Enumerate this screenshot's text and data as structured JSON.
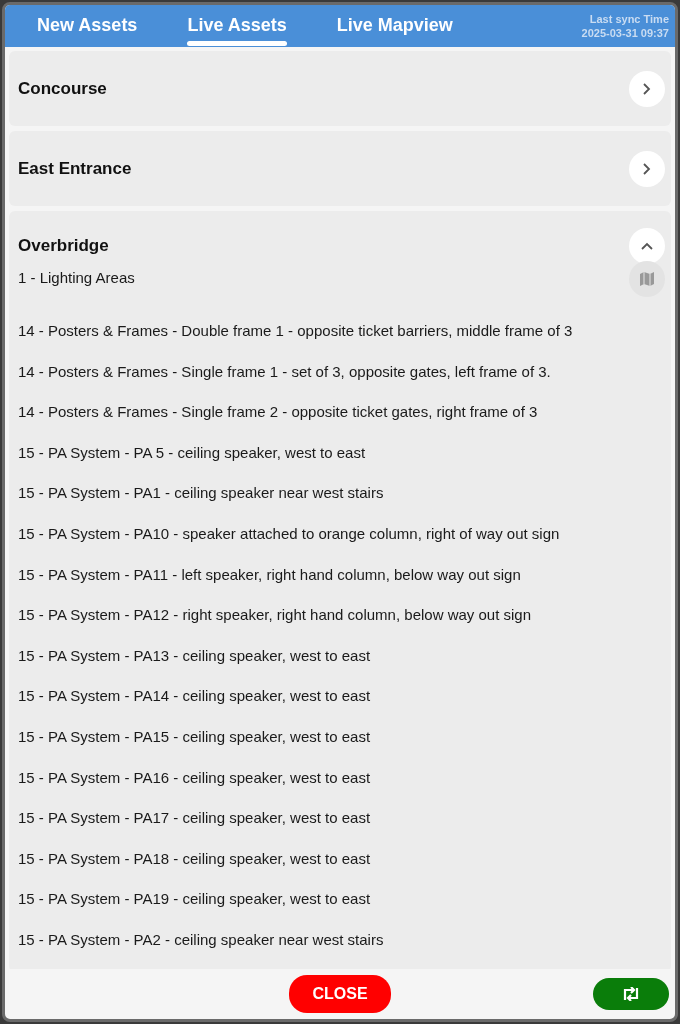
{
  "tabs": [
    {
      "label": "New Assets",
      "selected": false
    },
    {
      "label": "Live Assets",
      "selected": true
    },
    {
      "label": "Live Mapview",
      "selected": false
    }
  ],
  "sync": {
    "label": "Last sync Time",
    "time": "2025-03-31 09:37"
  },
  "sections": [
    {
      "title": "Concourse",
      "expanded": false
    },
    {
      "title": "East Entrance",
      "expanded": false
    },
    {
      "title": "Overbridge",
      "expanded": true,
      "items": [
        "1 - Lighting Areas",
        "14 - Posters & Frames - Double frame 1 - opposite ticket barriers, middle frame of 3",
        "14 - Posters & Frames - Single frame 1 - set of 3, opposite gates, left frame of 3.",
        "14 - Posters & Frames - Single frame 2 - opposite ticket gates, right frame of 3",
        "15 - PA System - PA 5 - ceiling speaker, west to east",
        "15 - PA System - PA1 - ceiling speaker near west stairs",
        "15 - PA System - PA10 - speaker attached to orange column, right of way out sign",
        "15 - PA System - PA11 - left speaker, right hand column, below way out sign",
        "15 - PA System - PA12 - right speaker, right hand column, below way out sign",
        "15 - PA System - PA13 - ceiling speaker, west to east",
        "15 - PA System - PA14 - ceiling speaker, west to east",
        "15 - PA System - PA15 - ceiling speaker, west to east",
        "15 - PA System - PA16 - ceiling speaker, west to east",
        "15 - PA System - PA17 - ceiling speaker, west to east",
        "15 - PA System - PA18 - ceiling speaker, west to east",
        "15 - PA System - PA19 - ceiling speaker, west to east",
        "15 - PA System - PA2 - ceiling speaker near west stairs"
      ]
    }
  ],
  "close_button": "CLOSE"
}
